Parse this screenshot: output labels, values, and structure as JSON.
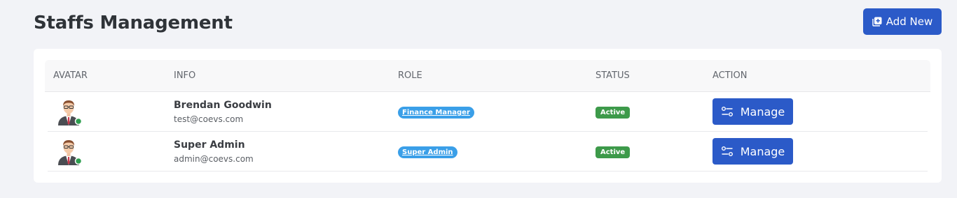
{
  "header": {
    "title": "Staffs Management",
    "add_button_label": "Add New"
  },
  "table": {
    "columns": [
      "AVATAR",
      "INFO",
      "ROLE",
      "STATUS",
      "ACTION"
    ],
    "rows": [
      {
        "name": "Brendan Goodwin",
        "email": "test@coevs.com",
        "role": "Finance Manager",
        "status": "Active",
        "action_label": "Manage"
      },
      {
        "name": "Super Admin",
        "email": "admin@coevs.com",
        "role": "Super Admin",
        "status": "Active",
        "action_label": "Manage"
      }
    ]
  },
  "colors": {
    "primary": "#2b5ac8",
    "role_badge": "#3a9fe8",
    "status_active": "#3d9a4a",
    "online_dot": "#2e9e4f",
    "background": "#f2f3f7"
  },
  "icons": {
    "add_button": "add-square-icon",
    "manage_button": "sliders-icon",
    "avatar": "user-avatar-icon"
  }
}
